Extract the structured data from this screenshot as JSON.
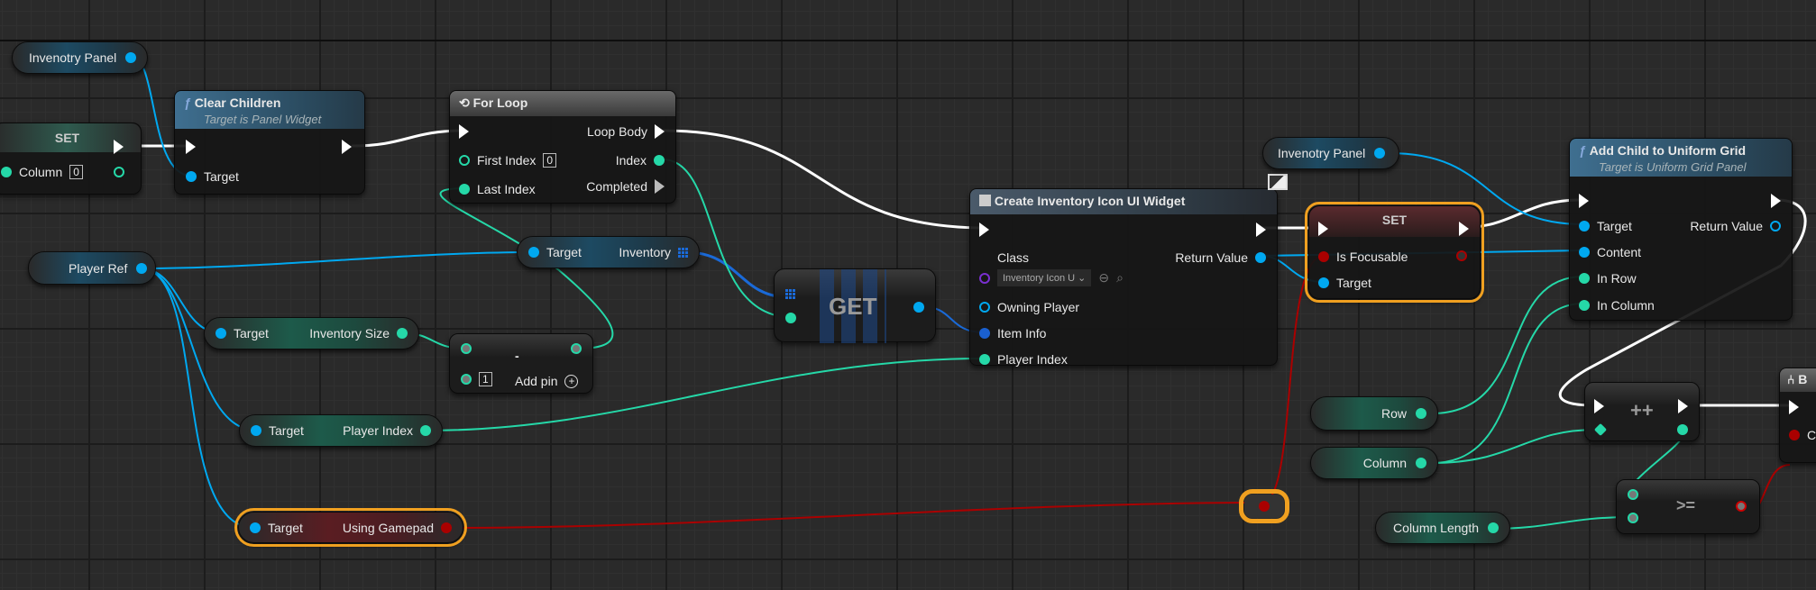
{
  "colors": {
    "exec": "#ffffff",
    "object": "#00a8f0",
    "integer": "#25d8a8",
    "boolean": "#aa0000",
    "selection": "#f0a020"
  },
  "nodes": {
    "inventory_panel_1": {
      "label": "Invenotry Panel"
    },
    "set_column": {
      "title": "SET",
      "pin": "Column",
      "value": "0"
    },
    "clear_children": {
      "title": "Clear Children",
      "subtitle": "Target is Panel Widget",
      "target": "Target",
      "icon": "function-icon"
    },
    "for_loop": {
      "title": "For Loop",
      "loop_body": "Loop Body",
      "first_index": "First Index",
      "first_value": "0",
      "index": "Index",
      "last_index": "Last Index",
      "completed": "Completed",
      "icon": "loop-icon"
    },
    "player_ref": {
      "label": "Player Ref"
    },
    "get_inventory": {
      "target": "Target",
      "output": "Inventory"
    },
    "get_node": {
      "title": "GET"
    },
    "get_inventory_size": {
      "target": "Target",
      "output": "Inventory Size"
    },
    "subtract": {
      "symbol": "-",
      "value": "1",
      "add_pin": "Add pin"
    },
    "get_player_index": {
      "target": "Target",
      "output": "Player Index"
    },
    "using_gamepad": {
      "target": "Target",
      "output": "Using Gamepad"
    },
    "create_widget": {
      "title": "Create Inventory Icon UI Widget",
      "class": "Class",
      "class_value": "Inventory Icon U",
      "return_value": "Return Value",
      "owning_player": "Owning Player",
      "item_info": "Item Info",
      "player_index": "Player Index"
    },
    "inventory_panel_2": {
      "label": "Invenotry Panel"
    },
    "set_focusable": {
      "title": "SET",
      "is_focusable": "Is Focusable",
      "target": "Target"
    },
    "add_child": {
      "title": "Add Child to Uniform Grid",
      "subtitle": "Target is Uniform Grid Panel",
      "target": "Target",
      "return_value": "Return Value",
      "content": "Content",
      "in_row": "In Row",
      "in_column": "In Column"
    },
    "row": {
      "label": "Row"
    },
    "column": {
      "label": "Column"
    },
    "column_length": {
      "label": "Column Length"
    },
    "increment": {
      "symbol": "++"
    },
    "greater_equal": {
      "symbol": ">="
    },
    "branch": {
      "title": "B",
      "pin": "C"
    }
  }
}
